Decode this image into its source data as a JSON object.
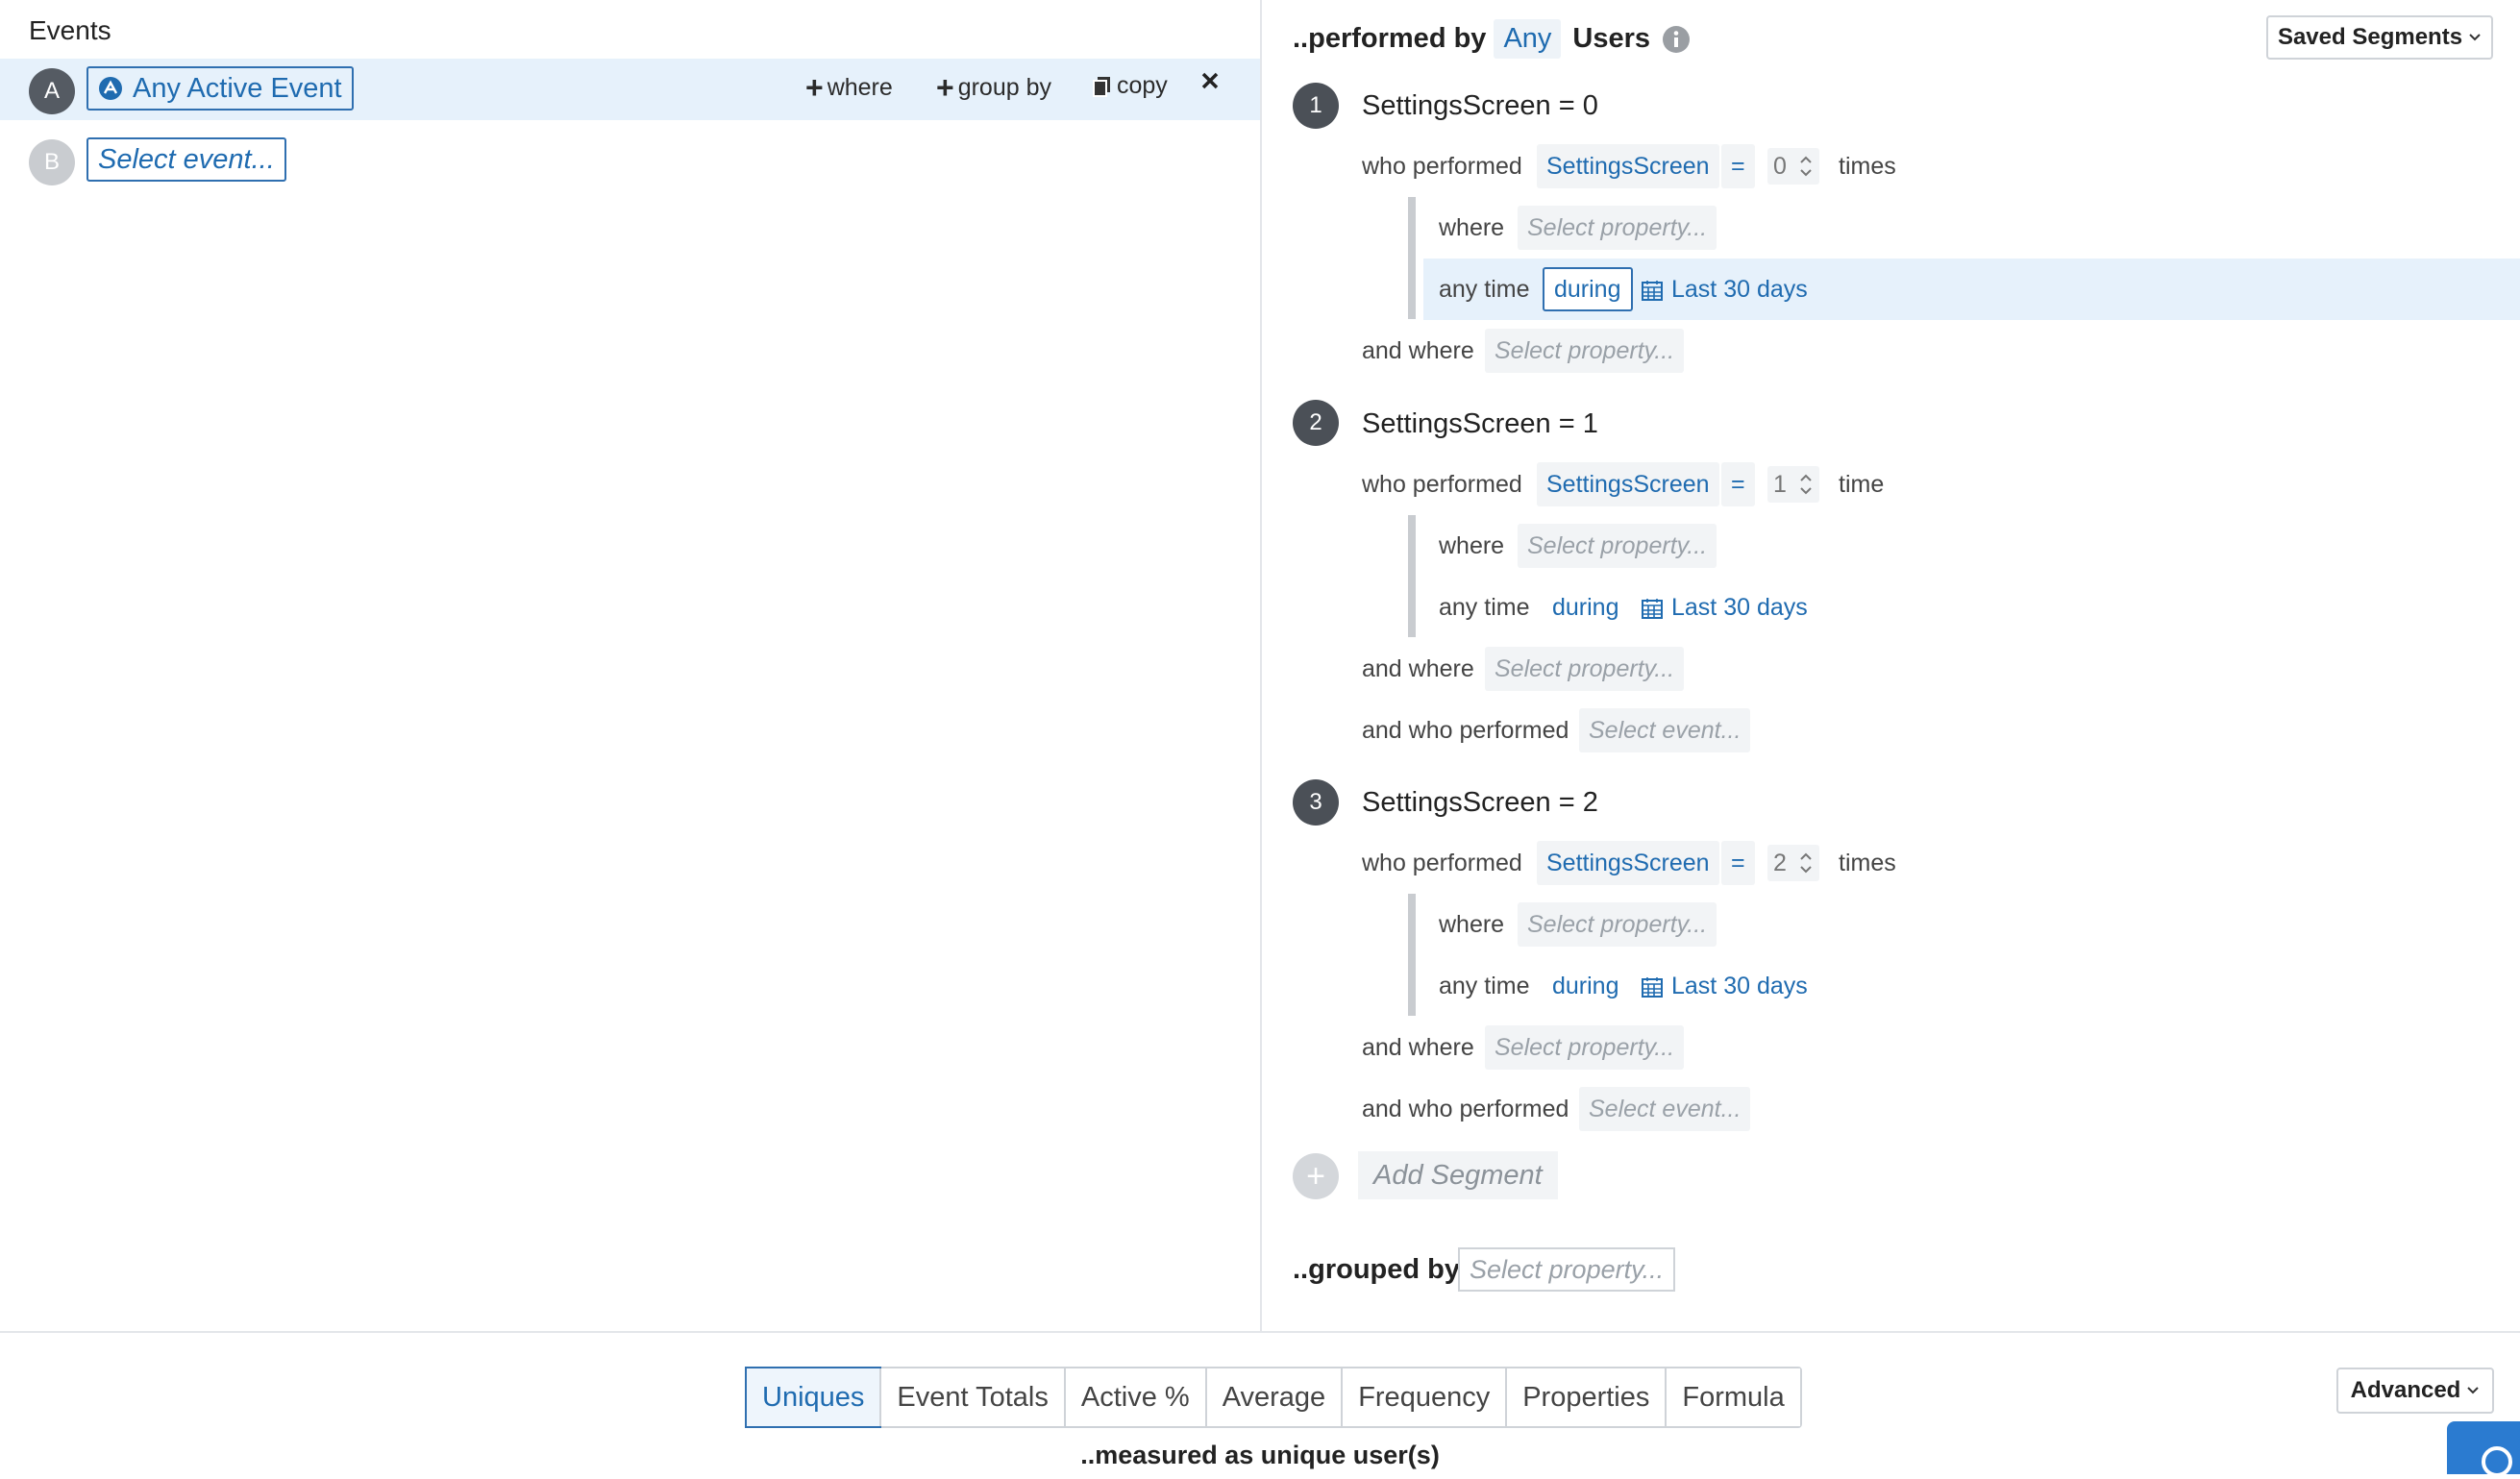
{
  "events": {
    "title": "Events",
    "rows": [
      {
        "letter": "A",
        "label": "Any Active Event",
        "icon": "any-event-icon"
      },
      {
        "letter": "B",
        "label": "Select event..."
      }
    ],
    "actions": {
      "where": "where",
      "group_by": "group by",
      "copy": "copy"
    }
  },
  "performed_by": {
    "prefix": "..performed by",
    "any": "Any",
    "users": "Users"
  },
  "saved_segments": "Saved Segments",
  "segments": [
    {
      "number": "1",
      "title": "SettingsScreen = 0",
      "who_performed": "who performed",
      "event": "SettingsScreen",
      "op": "=",
      "count": "0",
      "unit": "times",
      "where": "where",
      "where_placeholder": "Select property...",
      "any_time": "any time",
      "during": "during",
      "range": "Last 30 days",
      "and_where": "and where",
      "and_where_placeholder": "Select property..."
    },
    {
      "number": "2",
      "title": "SettingsScreen = 1",
      "who_performed": "who performed",
      "event": "SettingsScreen",
      "op": "=",
      "count": "1",
      "unit": "time",
      "where": "where",
      "where_placeholder": "Select property...",
      "any_time": "any time",
      "during": "during",
      "range": "Last 30 days",
      "and_where": "and where",
      "and_where_placeholder": "Select property...",
      "and_who": "and who performed",
      "and_who_placeholder": "Select event..."
    },
    {
      "number": "3",
      "title": "SettingsScreen = 2",
      "who_performed": "who performed",
      "event": "SettingsScreen",
      "op": "=",
      "count": "2",
      "unit": "times",
      "where": "where",
      "where_placeholder": "Select property...",
      "any_time": "any time",
      "during": "during",
      "range": "Last 30 days",
      "and_where": "and where",
      "and_where_placeholder": "Select property...",
      "and_who": "and who performed",
      "and_who_placeholder": "Select event..."
    }
  ],
  "add_segment": "Add Segment",
  "grouped_by": {
    "label": "..grouped by",
    "placeholder": "Select property..."
  },
  "measure_tabs": [
    "Uniques",
    "Event Totals",
    "Active %",
    "Average",
    "Frequency",
    "Properties",
    "Formula"
  ],
  "selected_tab": "Uniques",
  "measured_as": "..measured as unique user(s)",
  "advanced": "Advanced",
  "colors": {
    "accent": "#1f6bb0",
    "highlight": "#e6f1fb",
    "badge": "#4b5057"
  }
}
